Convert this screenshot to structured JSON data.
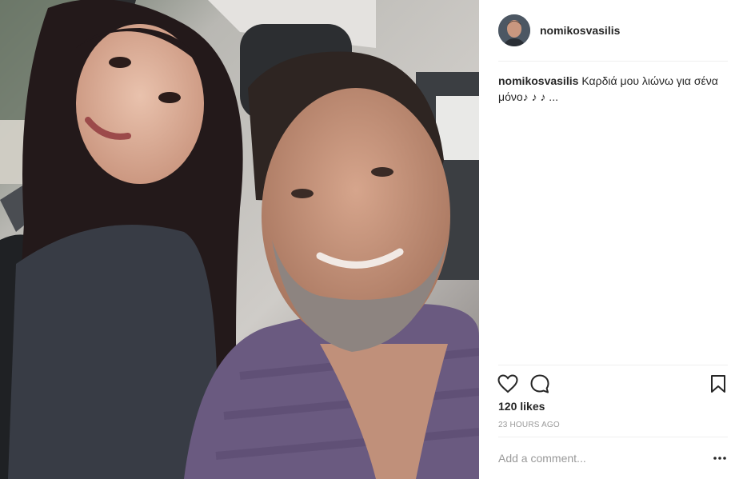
{
  "post": {
    "username": "nomikosvasilis",
    "caption": {
      "username": "nomikosvasilis",
      "text": "Καρδιά μου λιώνω για σένα μόνο♪ ♪ ♪ ..."
    },
    "likes": "120 likes",
    "timestamp": "23 HOURS AGO",
    "comment_placeholder": "Add a comment...",
    "icons": {
      "like": "heart-icon",
      "comment": "comment-bubble-icon",
      "save": "bookmark-icon",
      "more": "more-options-icon"
    },
    "colors": {
      "text": "#262626",
      "secondary_text": "#999999",
      "divider": "#efefef"
    }
  }
}
